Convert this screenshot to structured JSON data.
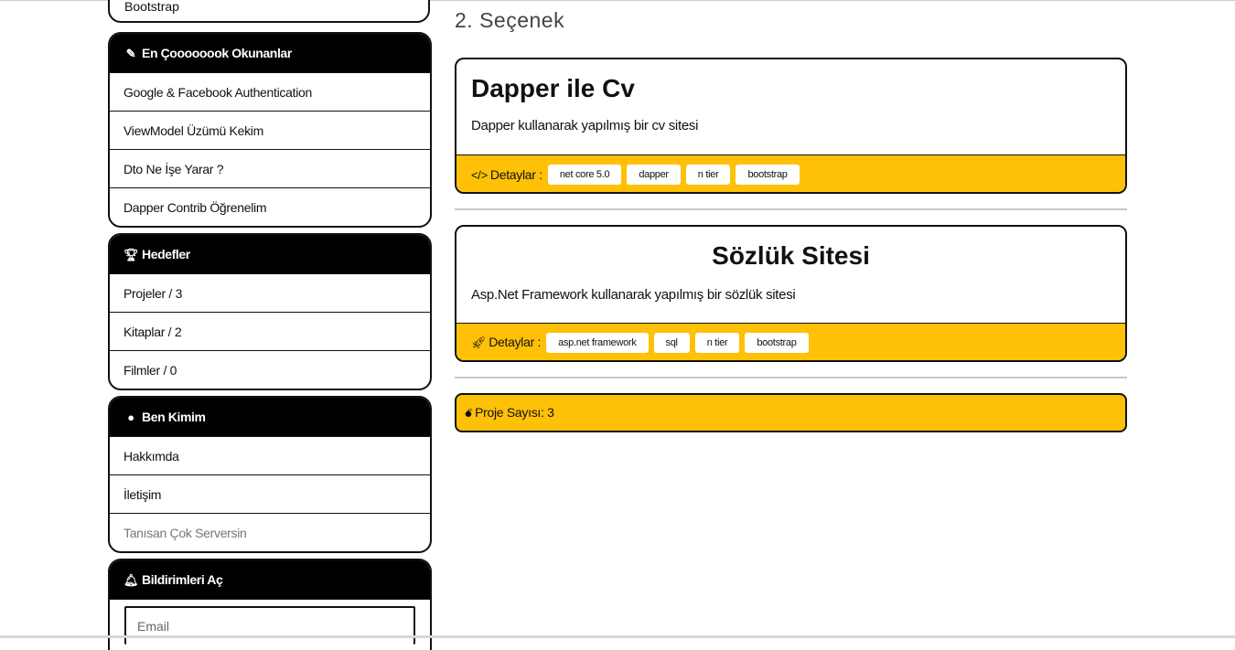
{
  "sidebar": {
    "stub_label": "Bootstrap",
    "popular": {
      "icon": "pencil-icon",
      "title": "En Çoooooook Okunanlar",
      "items": [
        "Google & Facebook Authentication",
        "ViewModel Üzümü Kekim",
        "Dto Ne İşe Yarar ?",
        "Dapper Contrib Öğrenelim"
      ]
    },
    "goals": {
      "icon": "trophy-icon",
      "title": "Hedefler",
      "items": [
        "Projeler / 3",
        "Kitaplar / 2",
        "Filmler / 0"
      ]
    },
    "about": {
      "icon": "user-icon",
      "title": "Ben Kimim",
      "items": [
        "Hakkımda",
        "İletişim",
        "Tanısan Çok Serversin"
      ]
    },
    "notify": {
      "icon": "bell-icon",
      "title": "Bildirimleri Aç",
      "email_placeholder": "Email"
    }
  },
  "main": {
    "heading": "2. Seçenek",
    "projects": [
      {
        "title": "Dapper ile Cv",
        "description": "Dapper kullanarak yapılmış bir cv sitesi",
        "details_icon": "code-icon",
        "details_label": "Detaylar :",
        "tags": [
          "net core 5.0",
          "dapper",
          "n tier",
          "bootstrap"
        ]
      },
      {
        "title": "Sözlük Sitesi",
        "description": "Asp.Net Framework kullanarak yapılmış bir sözlük sitesi",
        "details_icon": "rocket-icon",
        "details_label": "Detaylar :",
        "tags": [
          "asp.net framework",
          "sql",
          "n tier",
          "bootstrap"
        ]
      }
    ],
    "count_icon": "bomb-icon",
    "count_text": "Proje Sayısı: 3"
  },
  "colors": {
    "accent": "#ffc107",
    "header_bg": "#000000",
    "border": "#111111"
  }
}
